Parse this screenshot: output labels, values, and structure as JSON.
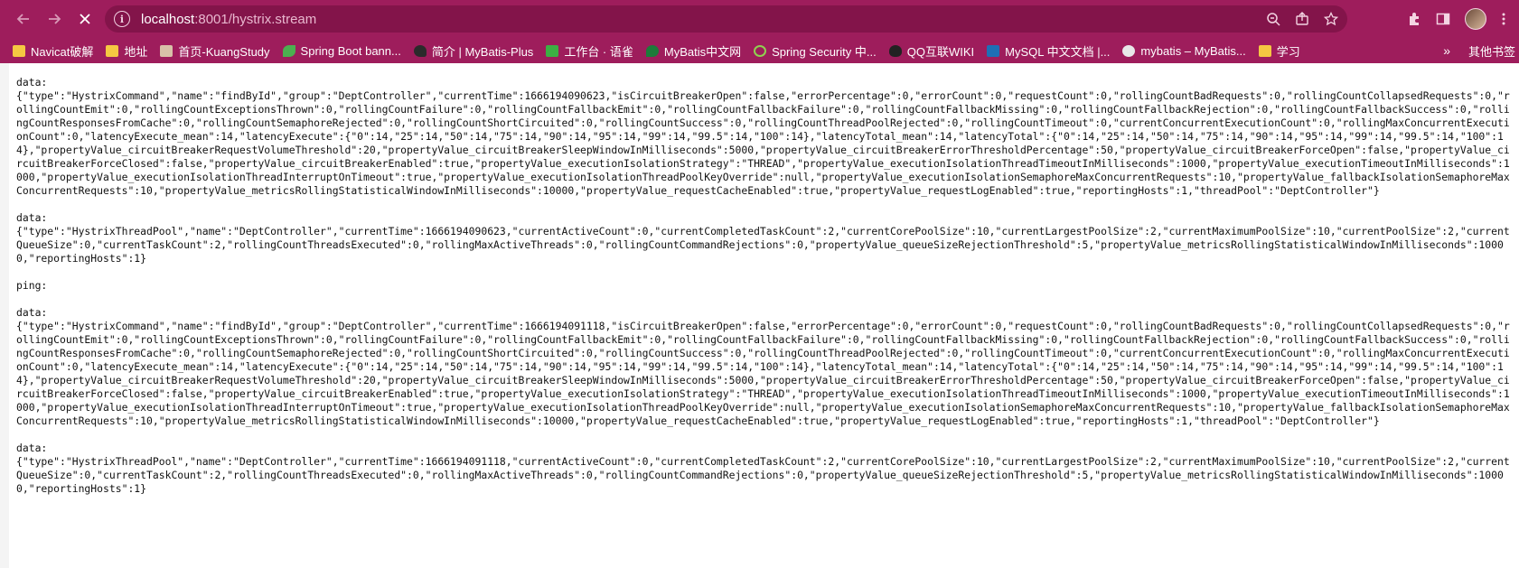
{
  "browser": {
    "url_host": "localhost",
    "url_rest": ":8001/hystrix.stream",
    "back_icon": "arrow-left-icon",
    "forward_icon": "arrow-right-icon",
    "stop_icon": "close-icon"
  },
  "bookmarks": [
    {
      "label": "Navicat破解",
      "icon": "folder"
    },
    {
      "label": "地址",
      "icon": "folder"
    },
    {
      "label": "首页-KuangStudy",
      "icon": "img"
    },
    {
      "label": "Spring Boot bann...",
      "icon": "leaf"
    },
    {
      "label": "简介 | MyBatis-Plus",
      "icon": "bird"
    },
    {
      "label": "工作台 · 语雀",
      "icon": "green"
    },
    {
      "label": "MyBatis中文网",
      "icon": "drop"
    },
    {
      "label": "Spring Security 中...",
      "icon": "ring"
    },
    {
      "label": "QQ互联WIKI",
      "icon": "penguin"
    },
    {
      "label": "MySQL 中文文档 |...",
      "icon": "mysql"
    },
    {
      "label": "mybatis – MyBatis...",
      "icon": "globe"
    },
    {
      "label": "学习",
      "icon": "folder"
    }
  ],
  "bookmarks_more": "»",
  "bookmarks_other": "其他书签",
  "stream": [
    {
      "label": "data:",
      "payload": "{\"type\":\"HystrixCommand\",\"name\":\"findById\",\"group\":\"DeptController\",\"currentTime\":1666194090623,\"isCircuitBreakerOpen\":false,\"errorPercentage\":0,\"errorCount\":0,\"requestCount\":0,\"rollingCountBadRequests\":0,\"rollingCountCollapsedRequests\":0,\"rollingCountEmit\":0,\"rollingCountExceptionsThrown\":0,\"rollingCountFailure\":0,\"rollingCountFallbackEmit\":0,\"rollingCountFallbackFailure\":0,\"rollingCountFallbackMissing\":0,\"rollingCountFallbackRejection\":0,\"rollingCountFallbackSuccess\":0,\"rollingCountResponsesFromCache\":0,\"rollingCountSemaphoreRejected\":0,\"rollingCountShortCircuited\":0,\"rollingCountSuccess\":0,\"rollingCountThreadPoolRejected\":0,\"rollingCountTimeout\":0,\"currentConcurrentExecutionCount\":0,\"rollingMaxConcurrentExecutionCount\":0,\"latencyExecute_mean\":14,\"latencyExecute\":{\"0\":14,\"25\":14,\"50\":14,\"75\":14,\"90\":14,\"95\":14,\"99\":14,\"99.5\":14,\"100\":14},\"latencyTotal_mean\":14,\"latencyTotal\":{\"0\":14,\"25\":14,\"50\":14,\"75\":14,\"90\":14,\"95\":14,\"99\":14,\"99.5\":14,\"100\":14},\"propertyValue_circuitBreakerRequestVolumeThreshold\":20,\"propertyValue_circuitBreakerSleepWindowInMilliseconds\":5000,\"propertyValue_circuitBreakerErrorThresholdPercentage\":50,\"propertyValue_circuitBreakerForceOpen\":false,\"propertyValue_circuitBreakerForceClosed\":false,\"propertyValue_circuitBreakerEnabled\":true,\"propertyValue_executionIsolationStrategy\":\"THREAD\",\"propertyValue_executionIsolationThreadTimeoutInMilliseconds\":1000,\"propertyValue_executionTimeoutInMilliseconds\":1000,\"propertyValue_executionIsolationThreadInterruptOnTimeout\":true,\"propertyValue_executionIsolationThreadPoolKeyOverride\":null,\"propertyValue_executionIsolationSemaphoreMaxConcurrentRequests\":10,\"propertyValue_fallbackIsolationSemaphoreMaxConcurrentRequests\":10,\"propertyValue_metricsRollingStatisticalWindowInMilliseconds\":10000,\"propertyValue_requestCacheEnabled\":true,\"propertyValue_requestLogEnabled\":true,\"reportingHosts\":1,\"threadPool\":\"DeptController\"}"
    },
    {
      "label": "data:",
      "payload": "{\"type\":\"HystrixThreadPool\",\"name\":\"DeptController\",\"currentTime\":1666194090623,\"currentActiveCount\":0,\"currentCompletedTaskCount\":2,\"currentCorePoolSize\":10,\"currentLargestPoolSize\":2,\"currentMaximumPoolSize\":10,\"currentPoolSize\":2,\"currentQueueSize\":0,\"currentTaskCount\":2,\"rollingCountThreadsExecuted\":0,\"rollingMaxActiveThreads\":0,\"rollingCountCommandRejections\":0,\"propertyValue_queueSizeRejectionThreshold\":5,\"propertyValue_metricsRollingStatisticalWindowInMilliseconds\":10000,\"reportingHosts\":1}"
    },
    {
      "label": "ping:",
      "payload": ""
    },
    {
      "label": "data:",
      "payload": "{\"type\":\"HystrixCommand\",\"name\":\"findById\",\"group\":\"DeptController\",\"currentTime\":1666194091118,\"isCircuitBreakerOpen\":false,\"errorPercentage\":0,\"errorCount\":0,\"requestCount\":0,\"rollingCountBadRequests\":0,\"rollingCountCollapsedRequests\":0,\"rollingCountEmit\":0,\"rollingCountExceptionsThrown\":0,\"rollingCountFailure\":0,\"rollingCountFallbackEmit\":0,\"rollingCountFallbackFailure\":0,\"rollingCountFallbackMissing\":0,\"rollingCountFallbackRejection\":0,\"rollingCountFallbackSuccess\":0,\"rollingCountResponsesFromCache\":0,\"rollingCountSemaphoreRejected\":0,\"rollingCountShortCircuited\":0,\"rollingCountSuccess\":0,\"rollingCountThreadPoolRejected\":0,\"rollingCountTimeout\":0,\"currentConcurrentExecutionCount\":0,\"rollingMaxConcurrentExecutionCount\":0,\"latencyExecute_mean\":14,\"latencyExecute\":{\"0\":14,\"25\":14,\"50\":14,\"75\":14,\"90\":14,\"95\":14,\"99\":14,\"99.5\":14,\"100\":14},\"latencyTotal_mean\":14,\"latencyTotal\":{\"0\":14,\"25\":14,\"50\":14,\"75\":14,\"90\":14,\"95\":14,\"99\":14,\"99.5\":14,\"100\":14},\"propertyValue_circuitBreakerRequestVolumeThreshold\":20,\"propertyValue_circuitBreakerSleepWindowInMilliseconds\":5000,\"propertyValue_circuitBreakerErrorThresholdPercentage\":50,\"propertyValue_circuitBreakerForceOpen\":false,\"propertyValue_circuitBreakerForceClosed\":false,\"propertyValue_circuitBreakerEnabled\":true,\"propertyValue_executionIsolationStrategy\":\"THREAD\",\"propertyValue_executionIsolationThreadTimeoutInMilliseconds\":1000,\"propertyValue_executionTimeoutInMilliseconds\":1000,\"propertyValue_executionIsolationThreadInterruptOnTimeout\":true,\"propertyValue_executionIsolationThreadPoolKeyOverride\":null,\"propertyValue_executionIsolationSemaphoreMaxConcurrentRequests\":10,\"propertyValue_fallbackIsolationSemaphoreMaxConcurrentRequests\":10,\"propertyValue_metricsRollingStatisticalWindowInMilliseconds\":10000,\"propertyValue_requestCacheEnabled\":true,\"propertyValue_requestLogEnabled\":true,\"reportingHosts\":1,\"threadPool\":\"DeptController\"}"
    },
    {
      "label": "data:",
      "payload": "{\"type\":\"HystrixThreadPool\",\"name\":\"DeptController\",\"currentTime\":1666194091118,\"currentActiveCount\":0,\"currentCompletedTaskCount\":2,\"currentCorePoolSize\":10,\"currentLargestPoolSize\":2,\"currentMaximumPoolSize\":10,\"currentPoolSize\":2,\"currentQueueSize\":0,\"currentTaskCount\":2,\"rollingCountThreadsExecuted\":0,\"rollingMaxActiveThreads\":0,\"rollingCountCommandRejections\":0,\"propertyValue_queueSizeRejectionThreshold\":5,\"propertyValue_metricsRollingStatisticalWindowInMilliseconds\":10000,\"reportingHosts\":1}"
    }
  ]
}
